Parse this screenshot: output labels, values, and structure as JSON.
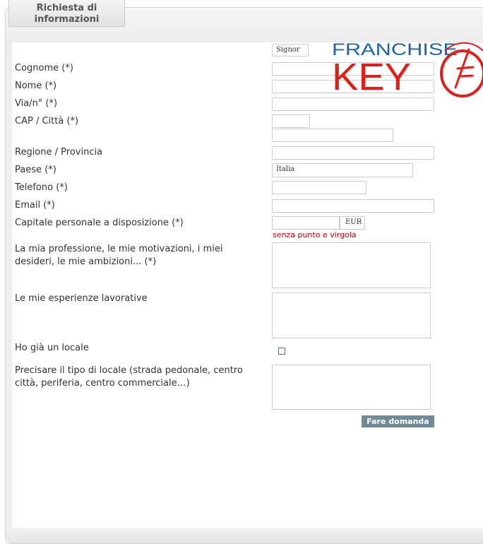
{
  "tab": {
    "line1": "Richiesta di",
    "line2": "informazioni"
  },
  "logo": {
    "top_text": "FRANCHISE",
    "bottom_text": "KEY",
    "colors": {
      "blue": "#1b66a8",
      "red": "#e0201b"
    }
  },
  "form": {
    "salutation_select": "Signor",
    "labels": {
      "cognome": "Cognome (*)",
      "nome": "Nome (*)",
      "via": "Via/n° (*)",
      "cap_citta": "CAP / Città (*)",
      "regione": "Regione / Provincia",
      "paese": "Paese (*)",
      "telefono": "Telefono (*)",
      "email": "Email (*)",
      "capitale": "Capitale personale a disposizione (*)",
      "professione": "La mia professione, le mie motivazioni, i miei desideri, le mie ambizioni... (*)",
      "esperienze": "Le mie esperienze lavorative",
      "locale": "Ho già un locale",
      "tipo_locale": "Precisare il tipo di locale (strada pedonale, centro città, periferia, centro commerciale…)"
    },
    "paese_value": "Italia",
    "currency": "EUR",
    "capitale_hint": "senza punto e virgola",
    "submit_label": "Fare domanda"
  }
}
